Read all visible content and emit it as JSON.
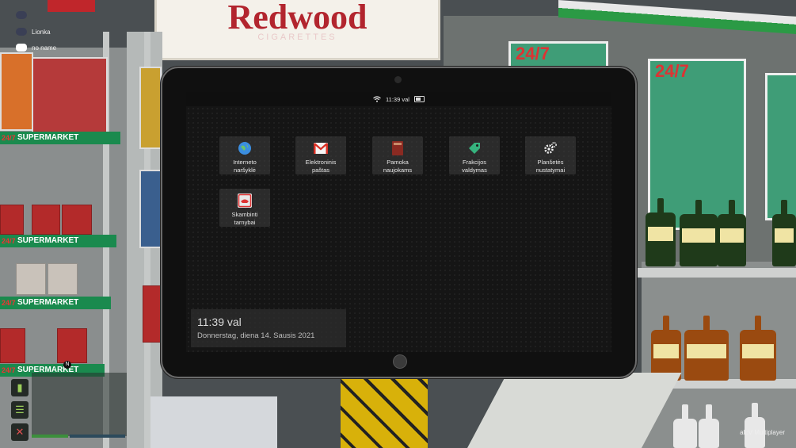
{
  "scene": {
    "sign_brand": "Redwood",
    "sign_sub": "CIGARETTES",
    "rack_label": "SUPERMARKET",
    "minimap_marker": "N"
  },
  "hud": {
    "players": [
      {
        "name": ""
      },
      {
        "name": "Lionka"
      },
      {
        "name": "no name"
      }
    ],
    "footer": "alt:V Multiplayer",
    "icons": [
      "battery-icon",
      "food-icon",
      "mic-muted-icon"
    ],
    "colors": {
      "health": "#3c8f3c",
      "hud_green": "#9ccf5a"
    }
  },
  "tablet": {
    "status": {
      "time": "11:39 val"
    },
    "apps": [
      {
        "id": "browser",
        "line1": "Interneto",
        "line2": "naršyklė",
        "icon": "globe-icon"
      },
      {
        "id": "mail",
        "line1": "Elektroninis",
        "line2": "paštas",
        "icon": "gmail-icon"
      },
      {
        "id": "guide",
        "line1": "Pamoka",
        "line2": "naujokams",
        "icon": "book-icon"
      },
      {
        "id": "faction",
        "line1": "Frakcijos",
        "line2": "valdymas",
        "icon": "tag-icon"
      },
      {
        "id": "settings",
        "line1": "Planšetės",
        "line2": "nustatymai",
        "icon": "gears-icon"
      },
      {
        "id": "emergency",
        "line1": "Skambinti",
        "line2": "tarnybai",
        "icon": "sos-phone-icon"
      }
    ],
    "clock": {
      "time": "11:39 val",
      "date": "Donnerstag, diena 14. Sausis 2021"
    }
  }
}
